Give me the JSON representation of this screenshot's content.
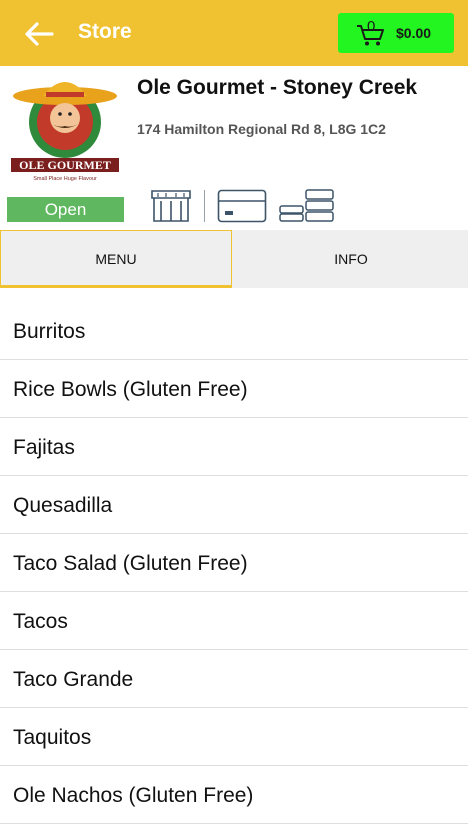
{
  "header": {
    "title": "Store",
    "cart_count": "0",
    "cart_total": "$0.00",
    "accent": "#f0c231",
    "cart_color": "#22f51f"
  },
  "store": {
    "name": "Ole Gourmet - Stoney Creek",
    "address": "174 Hamilton Regional Rd 8, L8G 1C2",
    "status": "Open",
    "logo_text": "OLE GOURMET",
    "logo_tagline": "Small Place Huge Flavour"
  },
  "tabs": [
    {
      "label": "MENU"
    },
    {
      "label": "INFO"
    }
  ],
  "menu": [
    {
      "label": "Burritos"
    },
    {
      "label": "Rice Bowls (Gluten Free)"
    },
    {
      "label": "Fajitas"
    },
    {
      "label": "Quesadilla"
    },
    {
      "label": "Taco Salad (Gluten Free)"
    },
    {
      "label": "Tacos"
    },
    {
      "label": "Taco Grande"
    },
    {
      "label": "Taquitos"
    },
    {
      "label": "Ole Nachos (Gluten Free)"
    }
  ]
}
